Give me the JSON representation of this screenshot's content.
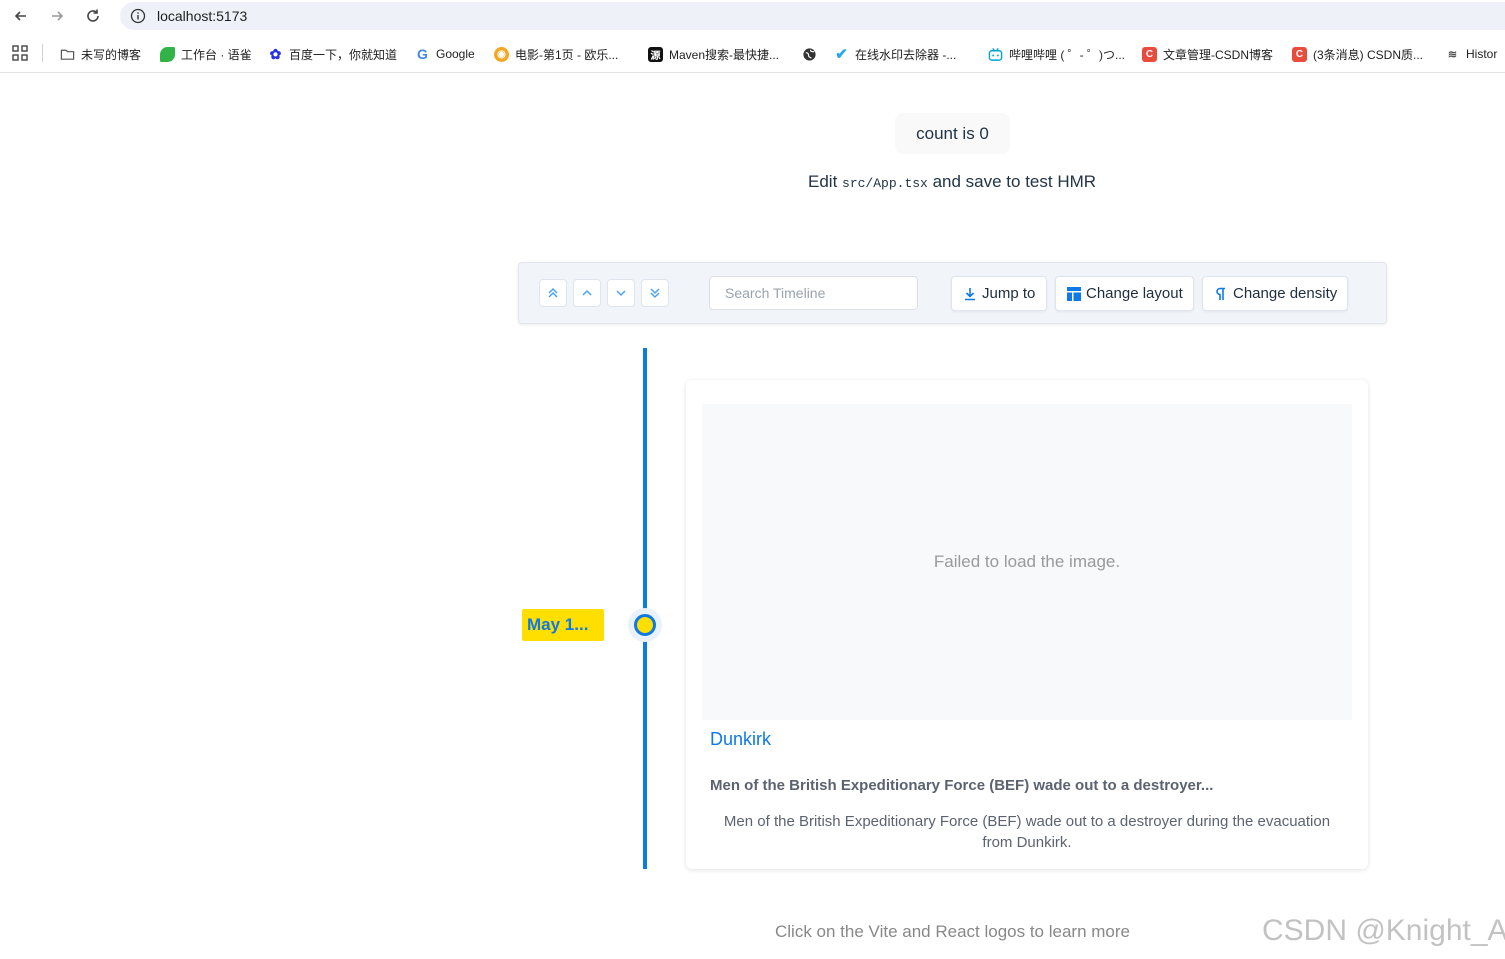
{
  "browser": {
    "url": "localhost:5173",
    "bookmarks": [
      {
        "label": "未写的博客",
        "icon": "folder-icon",
        "color": "#555555"
      },
      {
        "label": "工作台 · 语雀",
        "icon": "yuque-icon",
        "color": "#31b347"
      },
      {
        "label": "百度一下，你就知道",
        "icon": "baidu-icon",
        "color": "#2932e1"
      },
      {
        "label": "Google",
        "icon": "google-icon",
        "color": "#4285f4"
      },
      {
        "label": "电影-第1页 - 欧乐...",
        "icon": "movie-icon",
        "color": "#f5a623"
      },
      {
        "label": "Maven搜索-最快捷...",
        "icon": "maven-icon",
        "color": "#111111"
      },
      {
        "label": "",
        "icon": "globe-icon",
        "color": "#333333"
      },
      {
        "label": "在线水印去除器 -...",
        "icon": "watermark-tool-icon",
        "color": "#22a7f0"
      },
      {
        "label": "哔哩哔哩 ( ゜- ゜)つ...",
        "icon": "bilibili-icon",
        "color": "#00a1d6"
      },
      {
        "label": "文章管理-CSDN博客",
        "icon": "csdn-icon",
        "color": "#e84c3d"
      },
      {
        "label": "(3条消息) CSDN质...",
        "icon": "csdn-icon",
        "color": "#e84c3d"
      },
      {
        "label": "Histor",
        "icon": "history-icon",
        "color": "#555555"
      }
    ]
  },
  "page": {
    "count_label": "count is 0",
    "edit_prefix": "Edit ",
    "edit_code": "src/App.tsx",
    "edit_suffix": " and save to test HMR",
    "footer": "Click on the Vite and React logos to learn more",
    "watermark": "CSDN @Knight_AL"
  },
  "toolbar": {
    "search_placeholder": "Search Timeline",
    "jump_label": "Jump to",
    "layout_label": "Change layout",
    "density_label": "Change density"
  },
  "timeline": {
    "item": {
      "date": "May 1...",
      "media_error": "Failed to load the image.",
      "title": "Dunkirk",
      "subtitle": "Men of the British Expeditionary Force (BEF) wade out to a destroyer...",
      "text": "Men of the British Expeditionary Force (BEF) wade out to a destroyer during the evacuation from Dunkirk."
    }
  },
  "colors": {
    "accent": "#0f79e6",
    "date_bg": "#ffdf00",
    "toolbar_bg": "#f1f4f8"
  }
}
